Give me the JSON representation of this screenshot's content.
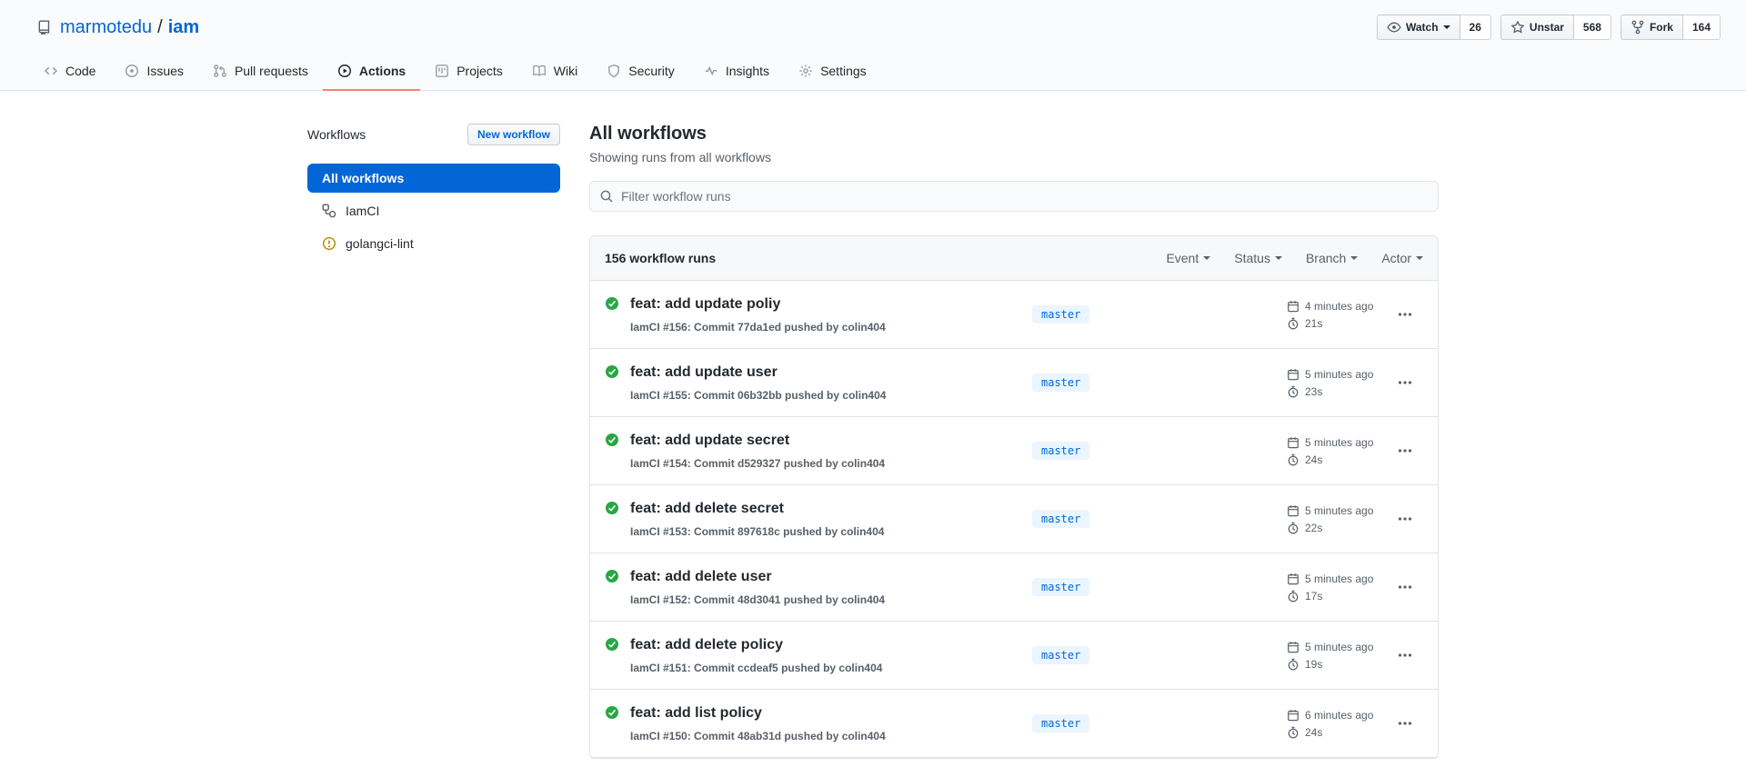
{
  "header": {
    "repo_owner": "marmotedu",
    "repo_separator": "/",
    "repo_name": "iam",
    "actions": [
      {
        "label": "Watch",
        "count": "26"
      },
      {
        "label": "Unstar",
        "count": "568"
      },
      {
        "label": "Fork",
        "count": "164"
      }
    ]
  },
  "tabs": [
    {
      "label": "Code"
    },
    {
      "label": "Issues"
    },
    {
      "label": "Pull requests"
    },
    {
      "label": "Actions",
      "active": true
    },
    {
      "label": "Projects"
    },
    {
      "label": "Wiki"
    },
    {
      "label": "Security"
    },
    {
      "label": "Insights"
    },
    {
      "label": "Settings"
    }
  ],
  "sidebar": {
    "title": "Workflows",
    "new_workflow_label": "New workflow",
    "items": [
      {
        "label": "All workflows",
        "selected": true
      },
      {
        "label": "IamCI",
        "icon": "workflow-icon"
      },
      {
        "label": "golangci-lint",
        "icon": "alert-icon"
      }
    ]
  },
  "main": {
    "title": "All workflows",
    "subtitle": "Showing runs from all workflows",
    "filter_placeholder": "Filter workflow runs",
    "runs_header": {
      "count_label": "156 workflow runs",
      "filters": [
        "Event",
        "Status",
        "Branch",
        "Actor"
      ]
    },
    "runs": [
      {
        "title": "feat: add update poliy",
        "meta": "IamCI #156: Commit 77da1ed pushed by colin404",
        "branch": "master",
        "time": "4 minutes ago",
        "duration": "21s"
      },
      {
        "title": "feat: add update user",
        "meta": "IamCI #155: Commit 06b32bb pushed by colin404",
        "branch": "master",
        "time": "5 minutes ago",
        "duration": "23s"
      },
      {
        "title": "feat: add update secret",
        "meta": "IamCI #154: Commit d529327 pushed by colin404",
        "branch": "master",
        "time": "5 minutes ago",
        "duration": "24s"
      },
      {
        "title": "feat: add delete secret",
        "meta": "IamCI #153: Commit 897618c pushed by colin404",
        "branch": "master",
        "time": "5 minutes ago",
        "duration": "22s"
      },
      {
        "title": "feat: add delete user",
        "meta": "IamCI #152: Commit 48d3041 pushed by colin404",
        "branch": "master",
        "time": "5 minutes ago",
        "duration": "17s"
      },
      {
        "title": "feat: add delete policy",
        "meta": "IamCI #151: Commit ccdeaf5 pushed by colin404",
        "branch": "master",
        "time": "5 minutes ago",
        "duration": "19s"
      },
      {
        "title": "feat: add list policy",
        "meta": "IamCI #150: Commit 48ab31d pushed by colin404",
        "branch": "master",
        "time": "6 minutes ago",
        "duration": "24s"
      }
    ]
  },
  "colors": {
    "accent": "#0366d6",
    "tab_underline": "#f9826c",
    "success": "#28a745",
    "warning": "#b08800",
    "badge_bg": "#eaf5ff"
  }
}
